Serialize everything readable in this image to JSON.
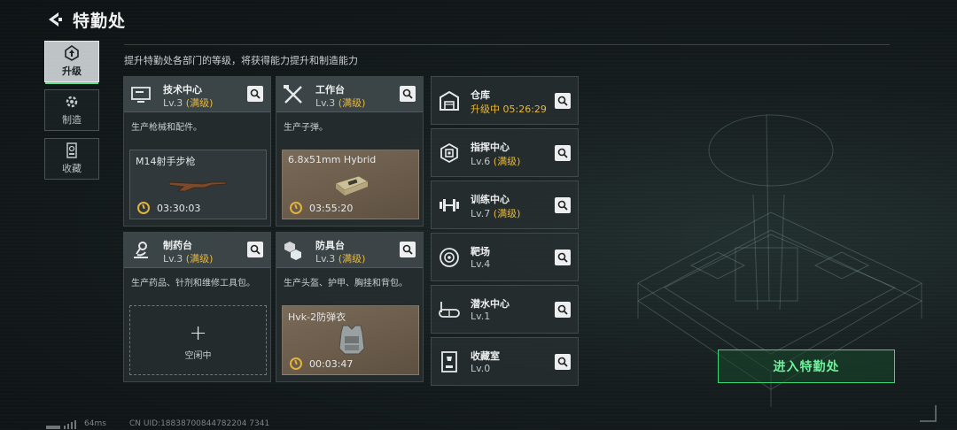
{
  "header": {
    "title": "特勤处"
  },
  "subtitle": "提升特勤处各部门的等级，将获得能力提升和制造能力",
  "nav": {
    "upgrade": "升级",
    "craft": "制造",
    "collect": "收藏"
  },
  "cards": [
    {
      "name": "技术中心",
      "level": "Lv.3",
      "max": "(满级)",
      "desc": "生产枪械和配件。",
      "item": "M14射手步枪",
      "time": "03:30:03",
      "icon": "computer-icon"
    },
    {
      "name": "工作台",
      "level": "Lv.3",
      "max": "(满级)",
      "desc": "生产子弹。",
      "item": "6.8x51mm Hybrid",
      "time": "03:55:20",
      "icon": "tools-icon"
    },
    {
      "name": "制药台",
      "level": "Lv.3",
      "max": "(满级)",
      "desc": "生产药品、针剂和维修工具包。",
      "idle_label": "空闲中",
      "icon": "microscope-icon"
    },
    {
      "name": "防具台",
      "level": "Lv.3",
      "max": "(满级)",
      "desc": "生产头盔、护甲、胸挂和背包。",
      "item": "Hvk-2防弹衣",
      "time": "00:03:47",
      "icon": "armor-boxes-icon"
    }
  ],
  "right_cards": [
    {
      "name": "仓库",
      "status": "升级中 05:26:29",
      "icon": "warehouse-icon"
    },
    {
      "name": "指挥中心",
      "level": "Lv.6",
      "max": "(满级)",
      "icon": "chip-icon"
    },
    {
      "name": "训练中心",
      "level": "Lv.7",
      "max": "(满级)",
      "icon": "dumbbell-icon"
    },
    {
      "name": "靶场",
      "level": "Lv.4",
      "icon": "target-icon"
    },
    {
      "name": "潜水中心",
      "level": "Lv.1",
      "icon": "diving-mask-icon"
    },
    {
      "name": "收藏室",
      "level": "Lv.0",
      "icon": "trophy-case-icon"
    }
  ],
  "enter_button": "进入特勤处",
  "footer": {
    "ping": "64ms",
    "uid": "CN UID:18838700844782204 7341"
  },
  "colors": {
    "accent_green": "#3ed67a",
    "max_gold": "#e8b93a"
  }
}
